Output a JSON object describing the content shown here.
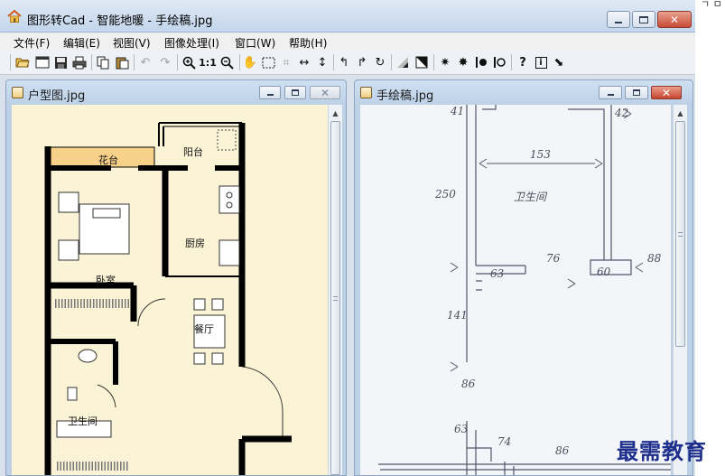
{
  "window": {
    "title": "图形转Cad - 智能地暖 - 手绘稿.jpg"
  },
  "menu": [
    "文件(F)",
    "编辑(E)",
    "视图(V)",
    "图像处理(I)",
    "窗口(W)",
    "帮助(H)"
  ],
  "toolbar": {
    "icons": [
      "open-folder-icon",
      "window-icon",
      "save-icon",
      "print-icon",
      "copy-icon",
      "paste-icon",
      "undo-icon",
      "redo-icon",
      "zoom-in-icon",
      "actual-size-icon",
      "zoom-out-icon",
      "pan-hand-icon",
      "select-rect-icon",
      "crop-icon",
      "flip-horizontal-icon",
      "flip-vertical-icon",
      "rotate-left-icon",
      "rotate-right-icon",
      "rotate-icon",
      "contrast-icon",
      "invert-icon",
      "brightness-up-icon",
      "brightness-down-icon",
      "sharpen-icon",
      "blur-icon",
      "help-icon",
      "info-icon",
      "pointer-icon"
    ],
    "actual_size_label": "1:1",
    "help_label": "?",
    "info_label": "i"
  },
  "left_window": {
    "title": "户型图.jpg",
    "rooms": {
      "flower_bed": "花台",
      "balcony": "阳台",
      "kitchen": "厨房",
      "bedroom": "卧室",
      "dining": "餐厅",
      "bathroom": "卫生间"
    }
  },
  "right_window": {
    "title": "手绘稿.jpg",
    "annotations": {
      "top_left": "41",
      "top_right": "42",
      "width_1": "153",
      "height_1": "250",
      "room_name": "卫生间",
      "dim_76": "76",
      "dim_88": "88",
      "dim_63a": "63",
      "dim_60": "60",
      "dim_141": "141",
      "dim_86a": "86",
      "dim_63b": "63",
      "dim_74": "74",
      "dim_86b": "86"
    }
  },
  "watermark": "最需教育",
  "colors": {
    "plan_background": "#fbf3d6",
    "flower_bed": "#f7d08a",
    "wall": "#000000",
    "sketch_paper": "#f4f5f8",
    "watermark": "#1f2f8c"
  }
}
